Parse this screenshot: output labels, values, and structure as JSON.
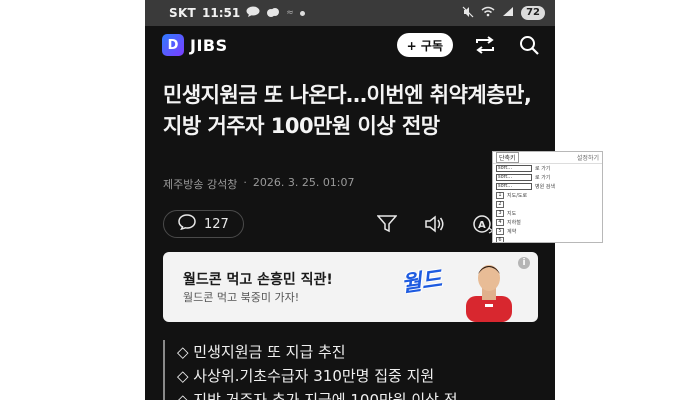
{
  "status_bar": {
    "carrier": "SKT",
    "time": "11:51",
    "battery": "72"
  },
  "app_bar": {
    "logo_letter": "D",
    "logo_name": "JIBS",
    "subscribe_label": "+ 구독"
  },
  "article": {
    "headline": "민생지원금 또 나온다…이번엔 취약계층만, 지방 거주자 100만원 이상 전망",
    "source": "제주방송 강석창",
    "date": "2026. 3. 25. 01:07",
    "comment_count": "127",
    "font_tool_label": "가"
  },
  "ad": {
    "title": "월드콘 먹고 손흥민 직관!",
    "subtitle": "월드콘 먹고 북중미 가자!",
    "brand": "월드",
    "info": "i"
  },
  "summary": {
    "items": [
      "◇ 민생지원금 또 지급 추진",
      "◇ 사상위.기초수급자 310만명 집중 지원",
      "◇ 지방 거주자 추가 지급에 100만원 이상 전"
    ]
  },
  "popup": {
    "title": "단축키",
    "link": "설정하기",
    "rows": [
      {
        "key": "",
        "input": "soft...",
        "label": "로 가기"
      },
      {
        "key": "",
        "input": "soft...",
        "label": "로 가기"
      },
      {
        "key": "",
        "input": "soft...",
        "label": "병원 검색"
      },
      {
        "key": "1",
        "input": "",
        "label": "지도/도로"
      },
      {
        "key": "2",
        "input": "",
        "label": ""
      },
      {
        "key": "3",
        "input": "",
        "label": "지도"
      },
      {
        "key": "4",
        "input": "",
        "label": "지하철"
      },
      {
        "key": "5",
        "input": "",
        "label": "계약"
      },
      {
        "key": "6",
        "input": "",
        "label": ""
      }
    ]
  },
  "colors": {
    "background": "#121212",
    "status_bar": "#3a3a3a",
    "ad_bg": "#f3f3f3",
    "brand_blue": "#1e5be0"
  }
}
